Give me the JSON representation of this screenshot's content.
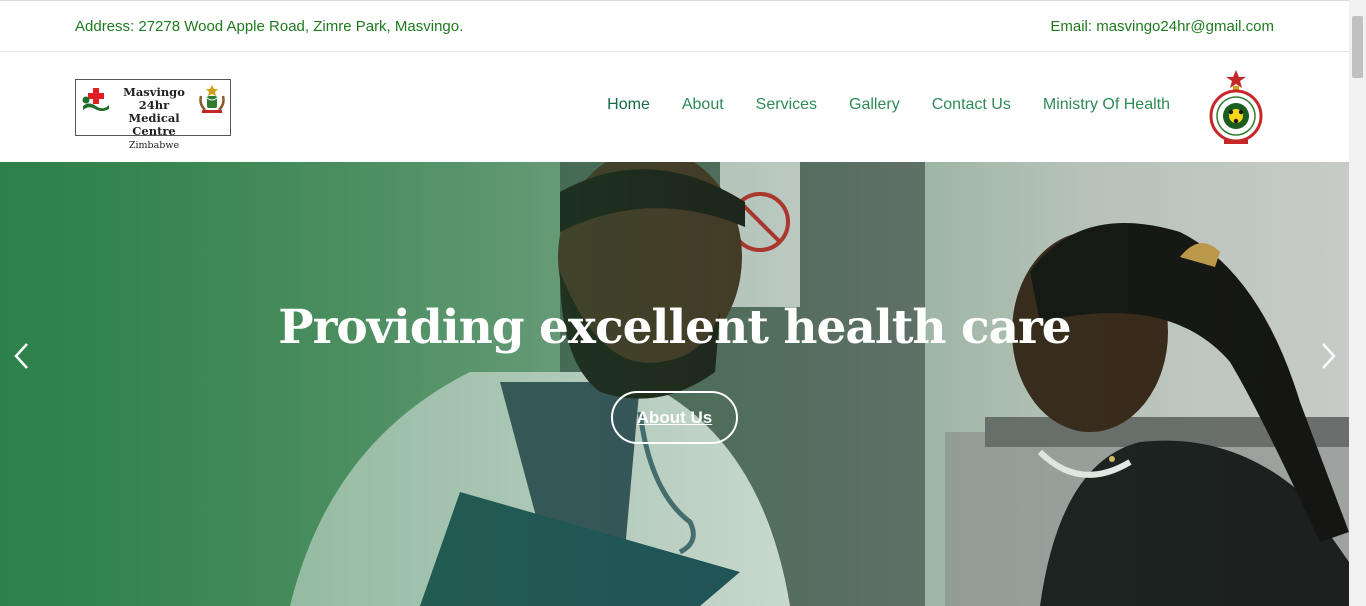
{
  "topbar": {
    "address": "Address: 27278 Wood Apple Road, Zimre Park, Masvingo.",
    "email": "Email: masvingo24hr@gmail.com"
  },
  "logo": {
    "line1": "Masvingo 24hr",
    "line2": "Medical Centre",
    "line3": "Zimbabwe"
  },
  "nav": {
    "items": [
      {
        "label": "Home",
        "active": true
      },
      {
        "label": "About"
      },
      {
        "label": "Services"
      },
      {
        "label": "Gallery"
      },
      {
        "label": "Contact Us"
      },
      {
        "label": "Ministry Of Health"
      }
    ]
  },
  "hero": {
    "heading": "Providing excellent health care",
    "button_label": "About Us"
  },
  "colors": {
    "brand_green": "#1e7a1e",
    "nav_green": "#2e8b57",
    "nav_active": "#146c43"
  },
  "icons": {
    "prev": "chevron-left-icon",
    "next": "chevron-right-icon"
  }
}
